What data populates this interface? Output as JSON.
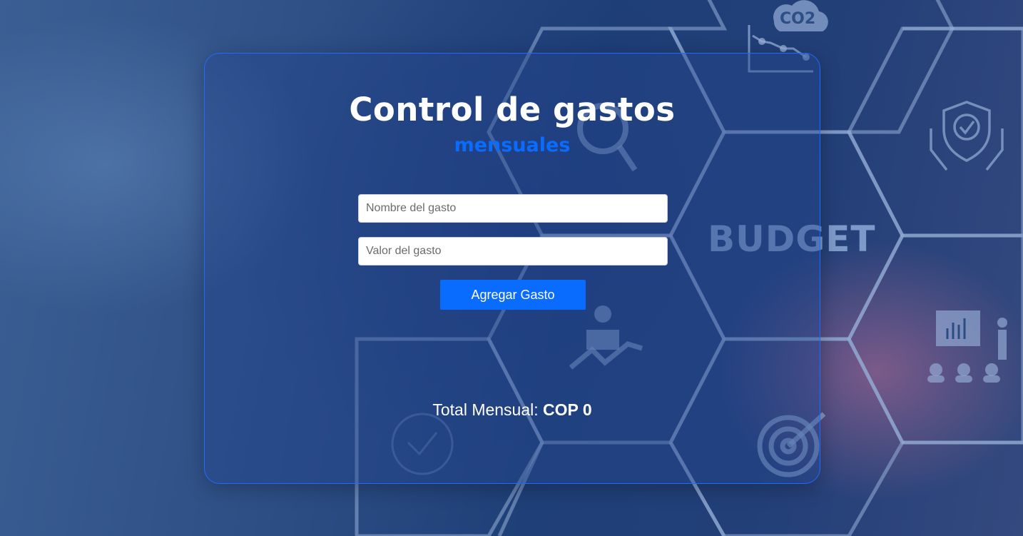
{
  "background": {
    "label": "BUDGET",
    "co2_label": "CO2",
    "icons": [
      "co2-cloud-icon",
      "line-chart-icon",
      "shield-check-icon",
      "presentation-icon",
      "team-icon",
      "target-icon",
      "magnifier-person-icon",
      "growth-person-icon",
      "checkmark-circle-icon"
    ]
  },
  "app": {
    "title": "Control de gastos",
    "subtitle": "mensuales",
    "accent_color": "#0a6cff"
  },
  "form": {
    "name_placeholder": "Nombre del gasto",
    "value_placeholder": "Valor del gasto",
    "add_button_label": "Agregar Gasto"
  },
  "summary": {
    "total_label": "Total Mensual:",
    "total_value": "COP 0"
  }
}
